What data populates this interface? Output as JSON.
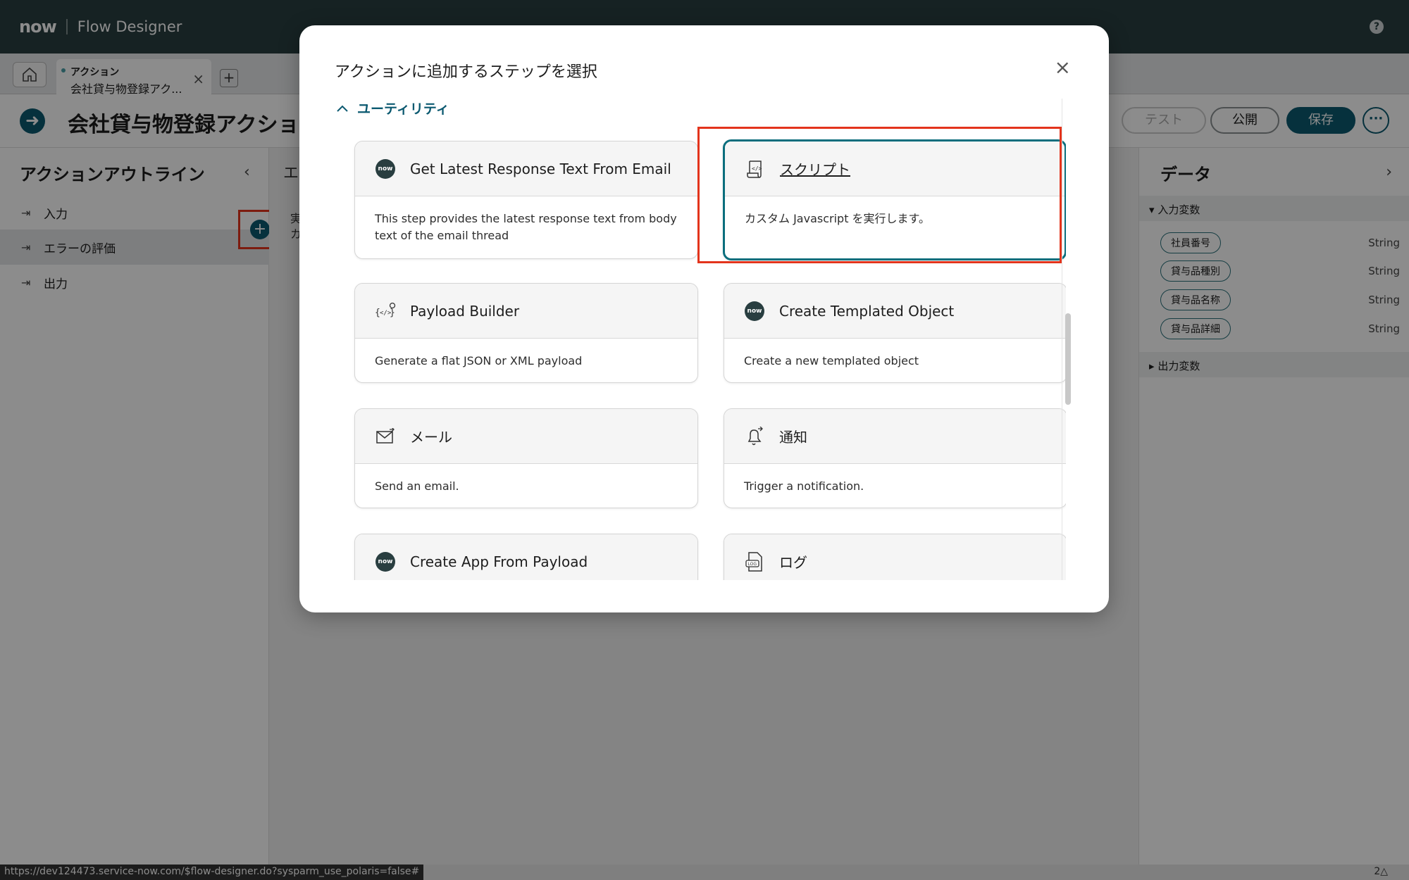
{
  "topbar": {
    "logo": "now",
    "app_title": "Flow Designer",
    "help_label": "?"
  },
  "tabs": {
    "active_type": "アクション",
    "active_name": "会社貸与物登録アク...",
    "close_label": "×",
    "add_label": "+"
  },
  "header": {
    "title": "会社貸与物登録アクション",
    "test_label": "テスト",
    "publish_label": "公開",
    "save_label": "保存",
    "more_label": "···"
  },
  "outline": {
    "title": "アクションアウトライン",
    "collapse_label": "‹",
    "items": [
      {
        "label": "入力",
        "icon": "input-icon"
      },
      {
        "label": "エラーの評価",
        "icon": "step-icon"
      },
      {
        "label": "出力",
        "icon": "output-icon"
      }
    ],
    "add_label": "+"
  },
  "canvas": {
    "tab_label": "エ",
    "text_line1": "実",
    "text_line2": "カ"
  },
  "data_panel": {
    "title": "データ",
    "expand_label": "›",
    "input_section": "入力変数",
    "output_section": "出力変数",
    "variables": [
      {
        "name": "社員番号",
        "type": "String"
      },
      {
        "name": "貸与品種別",
        "type": "String"
      },
      {
        "name": "貸与品名称",
        "type": "String"
      },
      {
        "name": "貸与品詳細",
        "type": "String"
      }
    ]
  },
  "modal": {
    "title": "アクションに追加するステップを選択",
    "close_label": "×",
    "section_label": "ユーティリティ",
    "cards": [
      {
        "title": "Get Latest Response Text From Email",
        "desc": "This step provides the latest response text from body text of the email thread",
        "icon": "now-logo-icon"
      },
      {
        "title": "スクリプト",
        "desc": "カスタム Javascript を実行します。",
        "icon": "script-icon"
      },
      {
        "title": "Payload Builder",
        "desc": "Generate a flat JSON or XML payload",
        "icon": "payload-icon"
      },
      {
        "title": "Create Templated Object",
        "desc": "Create a new templated object",
        "icon": "now-logo-icon"
      },
      {
        "title": "メール",
        "desc": "Send an email.",
        "icon": "email-icon"
      },
      {
        "title": "通知",
        "desc": "Trigger a notification.",
        "icon": "bell-icon"
      },
      {
        "title": "Create App From Payload",
        "desc": "",
        "icon": "now-logo-icon"
      },
      {
        "title": "ログ",
        "desc": "",
        "icon": "log-icon"
      }
    ]
  },
  "statusbar": {
    "url": "https://dev124473.service-now.com/$flow-designer.do?sysparm_use_polaris=false#",
    "right_text": "2△"
  },
  "colors": {
    "brand_dark": "#293e40",
    "accent": "#0b5970",
    "highlight_frame": "#e3341c"
  }
}
